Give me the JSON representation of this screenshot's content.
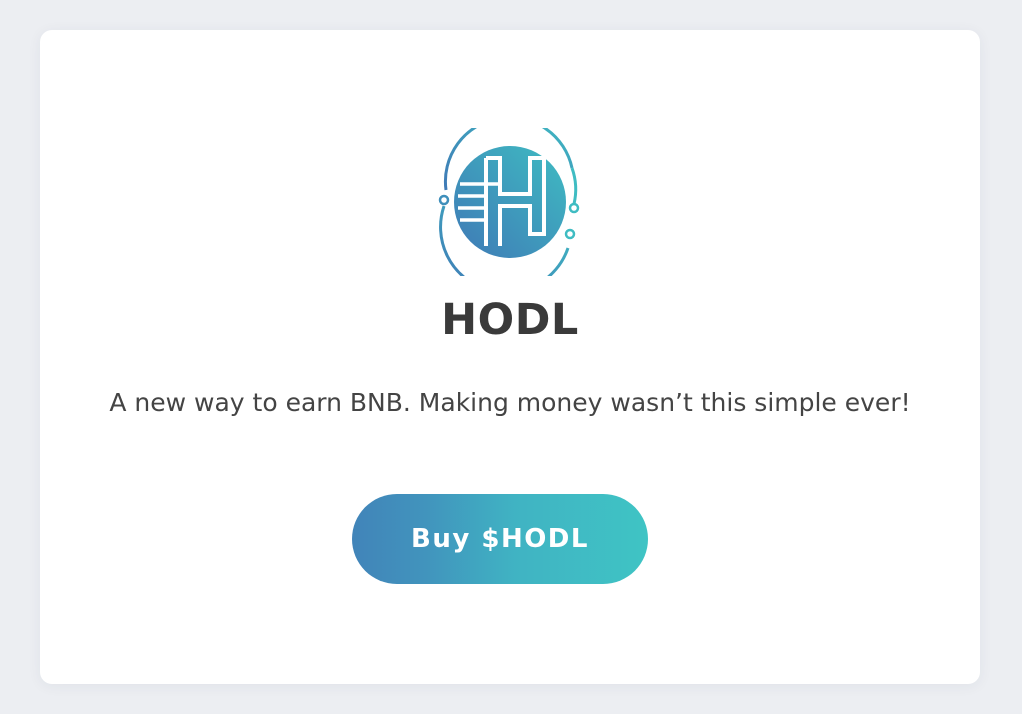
{
  "brand": {
    "logo_icon": "hodl-logo-icon",
    "title": "HODL",
    "tagline": "A new way to earn BNB. Making money wasn’t this simple ever!"
  },
  "cta": {
    "label": "Buy $HODL"
  },
  "colors": {
    "background": "#eceef2",
    "card": "#ffffff",
    "text": "#3a3a3a",
    "accent_start": "#4184b9",
    "accent_end": "#3fc4c4"
  }
}
